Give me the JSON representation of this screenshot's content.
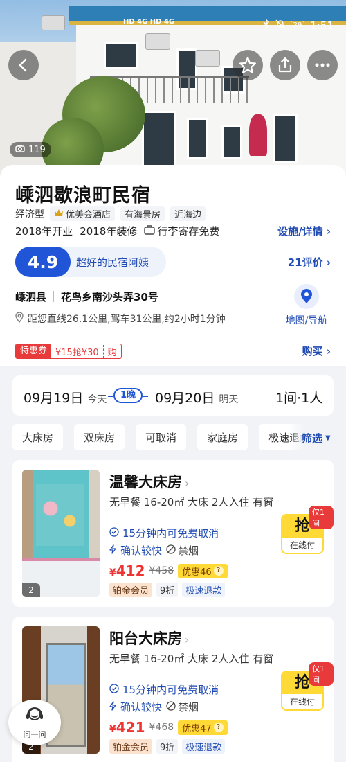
{
  "status_bar": {
    "network": "HD 4G HD 4G",
    "battery": "29",
    "time": "1:51"
  },
  "hero": {
    "photo_count": "119"
  },
  "hotel": {
    "name": "嵊泗歇浪町民宿",
    "type": "经济型",
    "brand_tag": "优美会酒店",
    "tags": [
      "有海景房",
      "近海边"
    ],
    "opened": "2018年开业",
    "renovated": "2018年装修",
    "luggage": "行李寄存免费",
    "facilities_link": "设施/详情",
    "rating": "4.9",
    "rating_text": "超好的民宿阿姨",
    "reviews_link": "21评价",
    "district": "嵊泗县",
    "address": "花鸟乡南沙头弄30号",
    "distance": "距您直线26.1公里,驾车31公里,约2小时1分钟",
    "map_label": "地图/导航"
  },
  "coupon": {
    "label": "特惠券",
    "offer": "¥15抢¥30",
    "buy_tag": "购",
    "buy_link": "购买"
  },
  "dates": {
    "checkin_month_day": "09月19日",
    "checkin_note": "今天",
    "nights": "1晚",
    "checkout_month_day": "09月20日",
    "checkout_note": "明天",
    "rooms_guests": "1间·1人"
  },
  "filters": {
    "chips": [
      "大床房",
      "双床房",
      "可取消",
      "家庭房",
      "极速退款"
    ],
    "filter_label": "筛选"
  },
  "rooms": [
    {
      "name": "温馨大床房",
      "desc": "无早餐 16-20㎡ 大床 2人入住 有窗",
      "cancel": "15分钟内可免费取消",
      "confirm": "确认较快",
      "smoke": "禁烟",
      "price_symbol": "¥",
      "price": "412",
      "old_price": "¥458",
      "discount": "优惠46",
      "badges": [
        "铂金会员",
        "9折",
        "极速退款"
      ],
      "image_count": "2",
      "grab": "抢",
      "pay": "在线付",
      "only": "仅1间"
    },
    {
      "name": "阳台大床房",
      "desc": "无早餐 16-20㎡ 大床 2人入住 有窗",
      "cancel": "15分钟内可免费取消",
      "confirm": "确认较快",
      "smoke": "禁烟",
      "price_symbol": "¥",
      "price": "421",
      "old_price": "¥468",
      "discount": "优惠47",
      "badges": [
        "铂金会员",
        "9折",
        "极速退款"
      ],
      "image_count": "2",
      "grab": "抢",
      "pay": "在线付",
      "only": "仅1间"
    }
  ],
  "ask": {
    "label": "问一问"
  }
}
